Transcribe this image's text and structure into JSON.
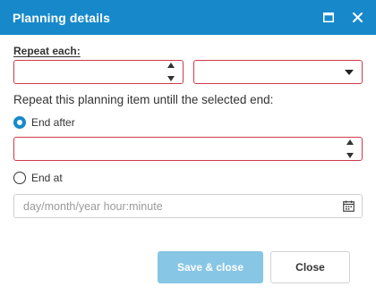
{
  "dialog": {
    "title": "Planning details",
    "icons": {
      "maximize": "maximize-icon",
      "close": "close-icon"
    }
  },
  "repeat": {
    "label": "Repeat each:",
    "count_value": "",
    "unit_value": ""
  },
  "sentence": "Repeat this planning item untill the selected end:",
  "end_after": {
    "label": "End after",
    "selected": true,
    "value": ""
  },
  "end_at": {
    "label": "End at",
    "selected": false,
    "placeholder": "day/month/year hour:minute"
  },
  "buttons": {
    "save": "Save & close",
    "close": "Close"
  },
  "colors": {
    "accent": "#1789cb",
    "error_border": "#cf3a4a",
    "primary_disabled": "#87c6e5"
  }
}
